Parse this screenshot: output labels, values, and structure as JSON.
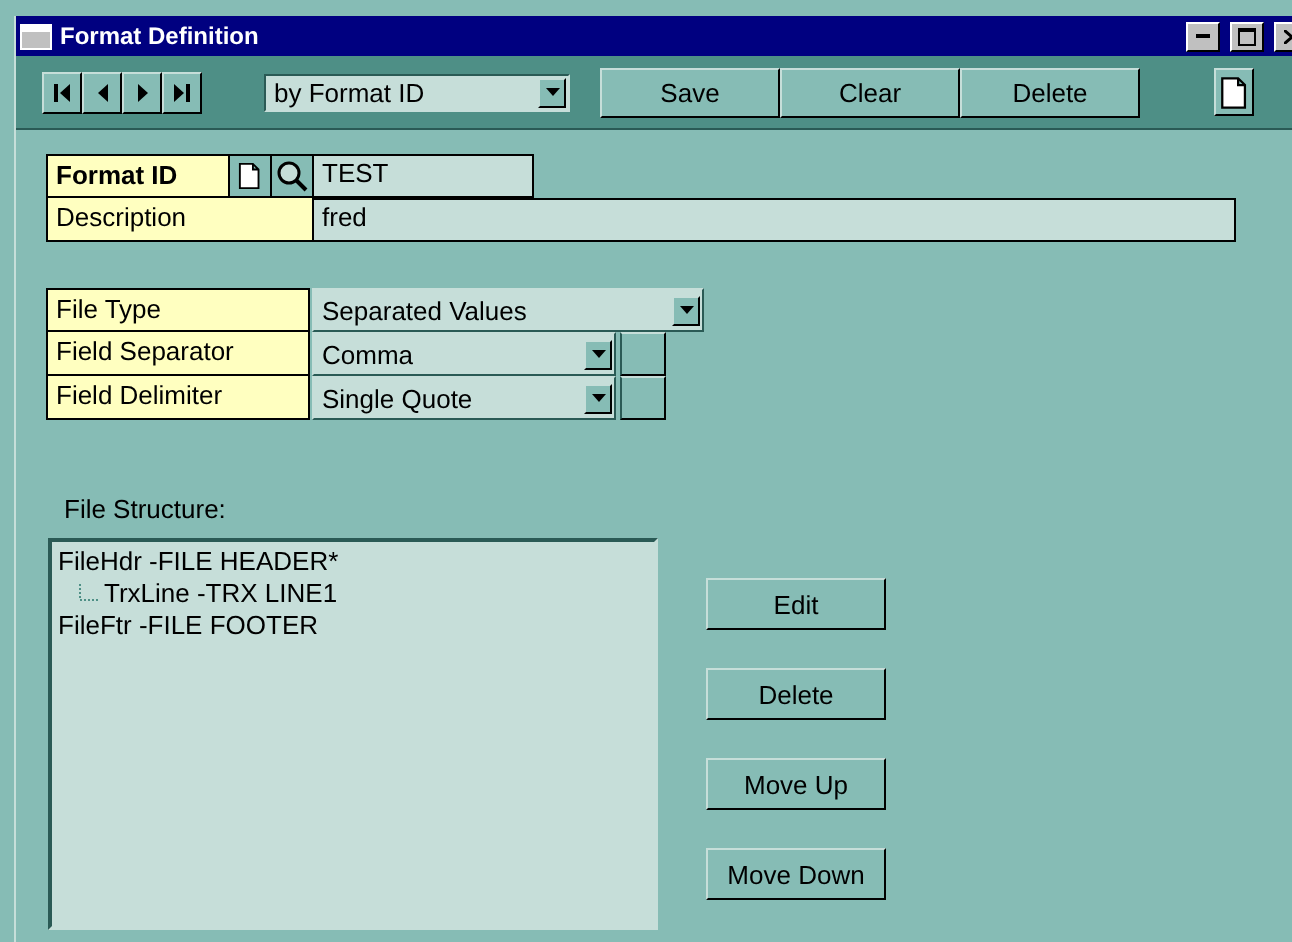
{
  "window": {
    "title": "Format Definition"
  },
  "toolbar": {
    "sort_by": "by Format ID",
    "buttons": [
      "Save",
      "Clear",
      "Delete"
    ]
  },
  "format_id": {
    "label": "Format ID",
    "value": "TEST"
  },
  "description": {
    "label": "Description",
    "value": "fred"
  },
  "file_settings": [
    {
      "label": "File Type",
      "value": "Separated Values",
      "kind": "wide"
    },
    {
      "label": "Field Separator",
      "value": "Comma",
      "kind": "narrow"
    },
    {
      "label": "Field Delimiter",
      "value": "Single Quote",
      "kind": "narrow"
    }
  ],
  "file_structure": {
    "label": "File Structure:",
    "items": [
      {
        "text": "FileHdr -FILE HEADER*",
        "children": [
          {
            "text": "TrxLine -TRX LINE1"
          }
        ]
      },
      {
        "text": "FileFtr -FILE FOOTER"
      }
    ]
  },
  "actions": [
    "Edit",
    "Delete",
    "Move Up",
    "Move Down"
  ]
}
